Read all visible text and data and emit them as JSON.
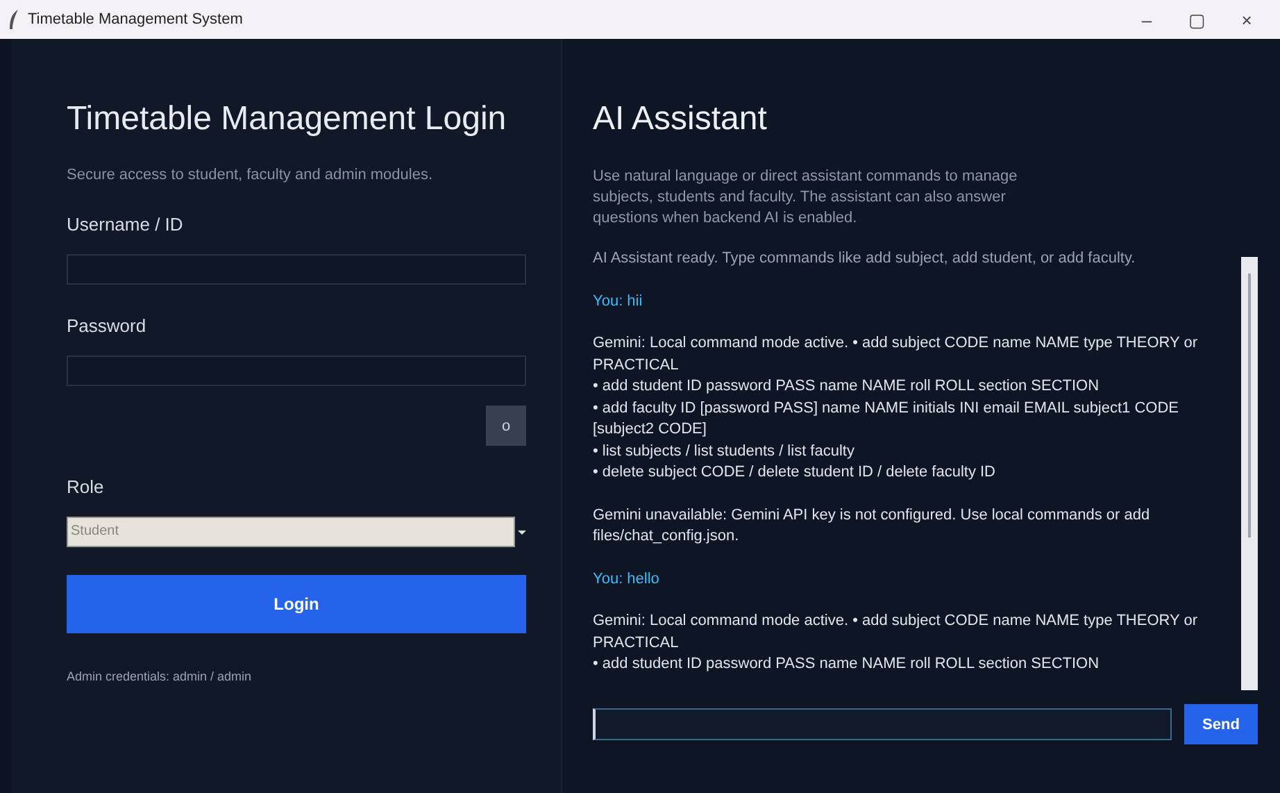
{
  "window": {
    "title": "Timetable Management System",
    "controls": [
      "–",
      "▢",
      "×"
    ]
  },
  "login": {
    "title": "Timetable Management Login",
    "subtitle": "Secure access to student, faculty and admin modules.",
    "fields": [
      {
        "label": "Username / ID",
        "kind": "text"
      },
      {
        "label": "Password",
        "kind": "password"
      }
    ],
    "show_password_button": "o",
    "role": {
      "label": "Role",
      "value": "Student"
    },
    "login_button": "Login",
    "note": "Admin credentials: admin / admin"
  },
  "assistant": {
    "title": "AI Assistant",
    "description": "Use natural language or direct assistant commands to manage subjects, students and faculty. The assistant can also answer questions when backend AI is enabled.",
    "messages": [
      {
        "kind": "system",
        "lines": [
          "AI Assistant ready. Type commands like add subject, add student, or add faculty."
        ]
      },
      {
        "kind": "user",
        "lines": [
          "You: hii"
        ]
      },
      {
        "kind": "bot",
        "lines": [
          "Gemini: Local command mode active. • add subject CODE name NAME type THEORY or PRACTICAL",
          "• add student ID password PASS name NAME roll ROLL section SECTION",
          "• add faculty ID [password PASS] name NAME initials INI email EMAIL subject1 CODE [subject2 CODE]",
          "• list subjects / list students / list faculty",
          "• delete subject CODE / delete student ID / delete faculty ID"
        ]
      },
      {
        "kind": "bot",
        "lines": [
          "Gemini unavailable: Gemini API key is not configured. Use local commands or add files/chat_config.json."
        ]
      },
      {
        "kind": "user",
        "lines": [
          "You: hello"
        ]
      },
      {
        "kind": "bot",
        "lines": [
          "Gemini: Local command mode active. • add subject CODE name NAME type THEORY or PRACTICAL",
          "• add student ID password PASS name NAME roll ROLL section SECTION"
        ]
      }
    ],
    "send_button": "Send"
  }
}
